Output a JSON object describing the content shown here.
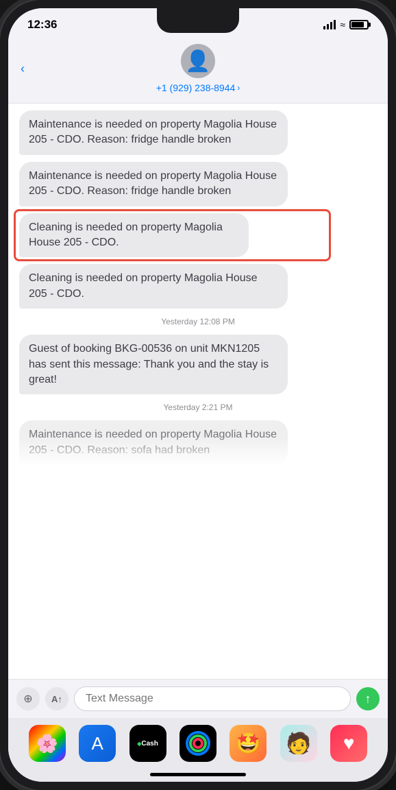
{
  "status_bar": {
    "time": "12:36",
    "signal_label": "signal",
    "wifi_label": "wifi",
    "battery_label": "battery"
  },
  "header": {
    "back_label": "‹",
    "phone_number": "+1 (929) 238-8944",
    "chevron": "›"
  },
  "messages": [
    {
      "id": 1,
      "text": "Maintenance is needed on property Magolia House 205 - CDO. Reason: fridge handle broken",
      "type": "received",
      "highlighted": false
    },
    {
      "id": 2,
      "text": "Maintenance is needed on property Magolia House 205 - CDO. Reason: fridge handle broken",
      "type": "received",
      "highlighted": false
    },
    {
      "id": 3,
      "text": "Cleaning is needed on property Magolia House 205 - CDO.",
      "type": "received",
      "highlighted": true
    },
    {
      "id": 4,
      "text": "Cleaning is needed on property Magolia House 205 - CDO.",
      "type": "received",
      "highlighted": false
    },
    {
      "id": 5,
      "timestamp": "Yesterday 12:08 PM",
      "text": "Guest of booking BKG-00536 on unit MKN1205 has sent this message: Thank you and the stay is great!",
      "type": "received",
      "highlighted": false
    },
    {
      "id": 6,
      "timestamp": "Yesterday 2:21 PM",
      "text": "Maintenance is needed on property Magolia House 205 - CDO. Reason: sofa had broken",
      "type": "received",
      "highlighted": false,
      "partial": true
    }
  ],
  "input": {
    "placeholder": "Text Message",
    "camera_icon": "📷",
    "apps_icon": "A"
  },
  "dock": {
    "apps": [
      {
        "name": "Photos",
        "type": "photos"
      },
      {
        "name": "App Store",
        "type": "appstore"
      },
      {
        "name": "Apple Cash",
        "type": "cash",
        "label": "Cash"
      },
      {
        "name": "Activity",
        "type": "activity"
      },
      {
        "name": "Memoji",
        "type": "memoji"
      },
      {
        "name": "Avatar",
        "type": "avatar2"
      },
      {
        "name": "Heart",
        "type": "heart"
      }
    ]
  }
}
